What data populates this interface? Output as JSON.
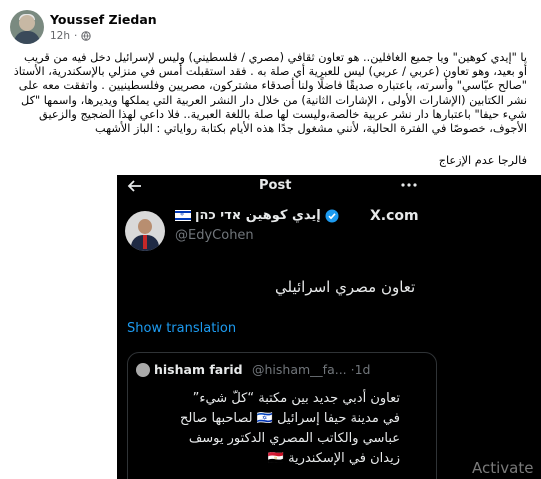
{
  "post": {
    "author": "Youssef Ziedan",
    "time": "12h",
    "dot": "·",
    "body": "يا \"إيدي كوهين\" ويا جميع الغافلين.. هو تعاون ثقافي (مصري / فلسطيني) وليس لإسرائيل دخل فيه من قريب أو بعيد، وهو تعاون (عربي / عربي) ليس للعبرية أي صلة به . فقد استقبلت أمس في منزلي بالإسكندرية، الأستاذ \"صالح عبّاسي\" وأسرته، باعتباره صديقًا فاضلًا ولنا أصدقاء مشتركون، مصريين وفلسطينيين . واتفقت معه على نشر الكتابين (الإشارات الأولى ، الإشارات الثانية) من خلال دار النشر العربية التي يملكها ويديرها، واسمها \"كل شيء حيفا\" باعتبارها دار نشر عربية خالصة،وليست لها صلة باللغة العبرية.. فلا داعي لهذا الضجيج والزعيق الأجوف، خصوصًا في الفترة الحالية، لأنني مشغول جدًا هذه الأيام بكتابة رواياتي : الباز الأشهب",
    "closing": "فالرجا عدم الإزعاج"
  },
  "screenshot": {
    "header_title": "Post",
    "author_name": "إيدي كوهين אדי כהן",
    "author_handle": "@EdyCohen",
    "platform": "X.com",
    "tweet_text": "تعاون مصري اسرائيلي",
    "translate_label": "Show translation",
    "quote": {
      "name": "hisham farid",
      "handle": "@hisham__fa... ·1d",
      "text": "تعاون أدبي جديد بين مكتبة “كلّ شيء” في مدينة حيفا إسرائيل 🇮🇱 لصاحبها صالح عباسي والكاتب المصري الدكتور يوسف زيدان في الإسكندرية 🇪🇬"
    },
    "watermark": "Activate"
  },
  "colors": {
    "link_blue": "#1d9bf0",
    "dark_bg": "#000000",
    "muted": "#71767b"
  },
  "icons": [
    "globe-icon",
    "back-arrow-icon",
    "more-icon",
    "verified-icon",
    "israel-flag-icon",
    "egypt-flag-icon",
    "x-logo-icon"
  ]
}
